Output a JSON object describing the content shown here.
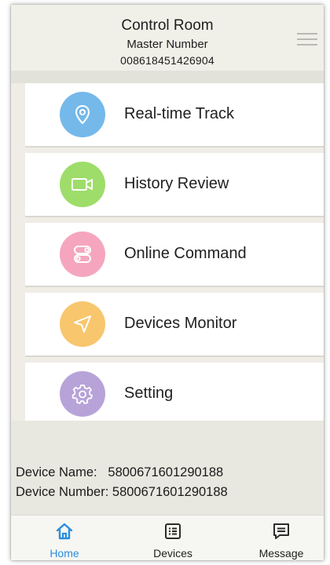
{
  "header": {
    "title": "Control Room",
    "subtitle": "Master Number",
    "number": "008618451426904",
    "menu_icon": "hamburger-menu-icon"
  },
  "menu": {
    "items": [
      {
        "label": "Real-time Track",
        "icon": "location-pin-icon",
        "color": "#74b9ea"
      },
      {
        "label": "History Review",
        "icon": "video-camera-icon",
        "color": "#9edd6a"
      },
      {
        "label": "Online Command",
        "icon": "toggle-switches-icon",
        "color": "#f5a6be"
      },
      {
        "label": "Devices Monitor",
        "icon": "navigation-arrow-icon",
        "color": "#f8c66d"
      },
      {
        "label": "Setting",
        "icon": "gear-icon",
        "color": "#b7a3d8"
      }
    ]
  },
  "device_info": {
    "name_label": "Device Name:",
    "name_value": "5800671601290188",
    "number_label": "Device Number:",
    "number_value": "5800671601290188"
  },
  "tabs": [
    {
      "label": "Home",
      "icon": "home-icon",
      "active": true
    },
    {
      "label": "Devices",
      "icon": "list-icon",
      "active": false
    },
    {
      "label": "Message",
      "icon": "message-icon",
      "active": false
    }
  ],
  "colors": {
    "accent": "#2a8de0"
  }
}
